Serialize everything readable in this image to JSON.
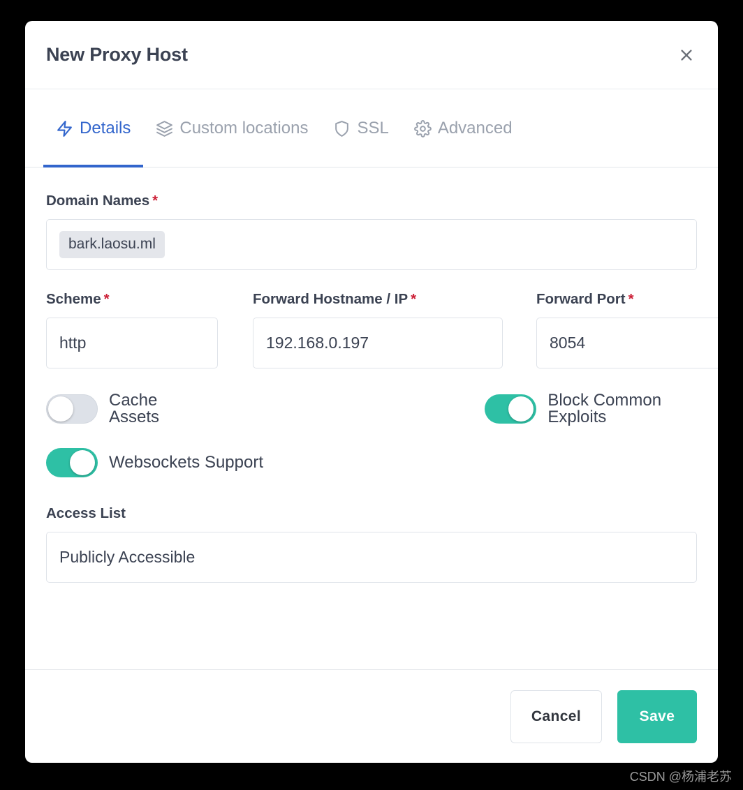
{
  "modal": {
    "title": "New Proxy Host",
    "close_icon": "close-icon"
  },
  "tabs": [
    {
      "label": "Details",
      "icon": "zap-icon",
      "active": true
    },
    {
      "label": "Custom locations",
      "icon": "layers-icon",
      "active": false
    },
    {
      "label": "SSL",
      "icon": "shield-icon",
      "active": false
    },
    {
      "label": "Advanced",
      "icon": "gear-icon",
      "active": false
    }
  ],
  "form": {
    "domain_names": {
      "label": "Domain Names",
      "required_marker": "*",
      "tags": [
        "bark.laosu.ml"
      ]
    },
    "scheme": {
      "label": "Scheme",
      "required_marker": "*",
      "value": "http"
    },
    "forward_hostname": {
      "label": "Forward Hostname / IP",
      "required_marker": "*",
      "value": "192.168.0.197"
    },
    "forward_port": {
      "label": "Forward Port",
      "required_marker": "*",
      "value": "8054"
    },
    "toggles": [
      {
        "label": "Cache Assets",
        "state": "off"
      },
      {
        "label": "Block Common Exploits",
        "state": "on"
      },
      {
        "label": "Websockets Support",
        "state": "on"
      }
    ],
    "access_list": {
      "label": "Access List",
      "value": "Publicly Accessible"
    }
  },
  "footer": {
    "cancel_label": "Cancel",
    "save_label": "Save"
  },
  "watermark": "CSDN @杨浦老苏",
  "colors": {
    "accent_teal": "#2ec0a5",
    "accent_blue": "#3265cc",
    "required_red": "#cc1f36",
    "text_dark": "#3b4252",
    "text_muted": "#9aa1ad",
    "border": "#dfe3e9",
    "tag_bg": "#e4e6eb",
    "backdrop": "#000000"
  }
}
